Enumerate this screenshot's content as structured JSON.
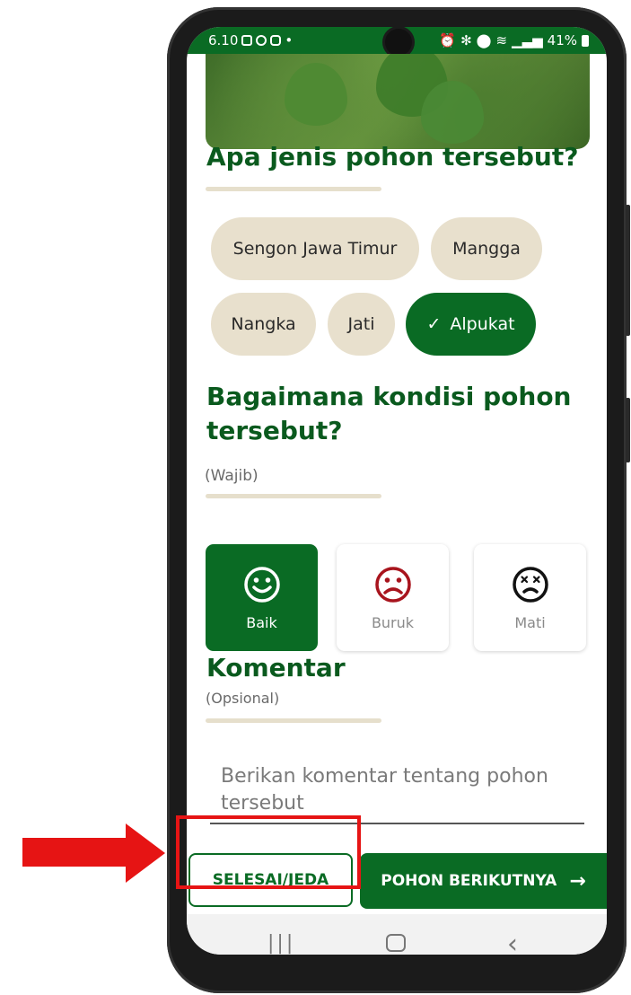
{
  "status_bar": {
    "time": "6.10",
    "left_icons": [
      "image-icon",
      "whatsapp-icon",
      "instagram-icon",
      "dot-icon"
    ],
    "right_icons": [
      "alarm-icon",
      "bluetooth-icon",
      "location-icon",
      "wifi-icon",
      "signal-icon"
    ],
    "battery": "41%"
  },
  "question_species": {
    "title": "Apa jenis pohon tersebut?",
    "options": [
      {
        "label": "Sengon Jawa Timur",
        "selected": false
      },
      {
        "label": "Mangga",
        "selected": false
      },
      {
        "label": "Nangka",
        "selected": false
      },
      {
        "label": "Jati",
        "selected": false
      },
      {
        "label": "Alpukat",
        "selected": true
      }
    ]
  },
  "question_condition": {
    "title": "Bagaimana kondisi pohon tersebut?",
    "title_line1": "Bagaimana kondisi pohon",
    "title_line2": "tersebut?",
    "required_note": "(Wajib)",
    "options": [
      {
        "label": "Baik",
        "icon": "smile-icon",
        "selected": true
      },
      {
        "label": "Buruk",
        "icon": "sad-icon",
        "selected": false
      },
      {
        "label": "Mati",
        "icon": "dead-icon",
        "selected": false
      }
    ]
  },
  "comment": {
    "title": "Komentar",
    "optional_note": "(Opsional)",
    "placeholder_line1": "Berikan komentar tentang pohon",
    "placeholder_line2": "tersebut"
  },
  "actions": {
    "finish_label": "SELESAI/JEDA",
    "next_label": "POHON BERIKUTNYA",
    "next_icon": "arrow-right-icon"
  },
  "colors": {
    "primary": "#0a6b24",
    "chip": "#e8e0cd",
    "sad_icon": "#a8141d",
    "annotation": "#e61414"
  }
}
